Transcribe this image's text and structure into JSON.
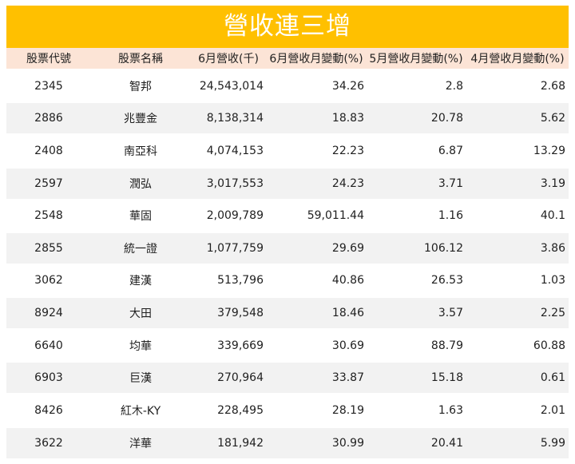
{
  "title": "營收連三增",
  "columns": [
    "股票代號",
    "股票名稱",
    "6月營收(千)",
    "6月營收月變動(%)",
    "5月營收月變動(%)",
    "4月營收月變動(%)"
  ],
  "rows": [
    [
      "2345",
      "智邦",
      "24,543,014",
      "34.26",
      "2.8",
      "2.68"
    ],
    [
      "2886",
      "兆豐金",
      "8,138,314",
      "18.83",
      "20.78",
      "5.62"
    ],
    [
      "2408",
      "南亞科",
      "4,074,153",
      "22.23",
      "6.87",
      "13.29"
    ],
    [
      "2597",
      "潤弘",
      "3,017,553",
      "24.23",
      "3.71",
      "3.19"
    ],
    [
      "2548",
      "華固",
      "2,009,789",
      "59,011.44",
      "1.16",
      "40.1"
    ],
    [
      "2855",
      "統一證",
      "1,077,759",
      "29.69",
      "106.12",
      "3.86"
    ],
    [
      "3062",
      "建漢",
      "513,796",
      "40.86",
      "26.53",
      "1.03"
    ],
    [
      "8924",
      "大田",
      "379,548",
      "18.46",
      "3.57",
      "2.25"
    ],
    [
      "6640",
      "均華",
      "339,669",
      "30.69",
      "88.79",
      "60.88"
    ],
    [
      "6903",
      "巨漢",
      "270,964",
      "33.87",
      "15.18",
      "0.61"
    ],
    [
      "8426",
      "紅木-KY",
      "228,495",
      "28.19",
      "1.63",
      "2.01"
    ],
    [
      "3622",
      "洋華",
      "181,942",
      "30.99",
      "20.41",
      "5.99"
    ]
  ],
  "colors": {
    "title_bg": "#FFC000",
    "header_bg": "#FCE4D6",
    "alt_row_bg": "#F2F2F2"
  }
}
